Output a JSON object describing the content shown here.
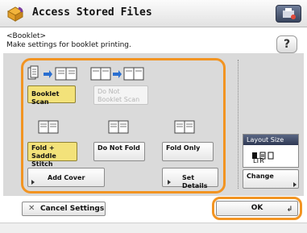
{
  "title": "Access Stored Files",
  "header": {
    "line1": "<Booklet>",
    "line2": "Make settings for booklet printing."
  },
  "help_label": "?",
  "options": {
    "booklet_scan": "Booklet Scan",
    "do_not_booklet_scan_1": "Do Not",
    "do_not_booklet_scan_2": "Booklet Scan",
    "fold_saddle_1": "Fold +",
    "fold_saddle_2": "Saddle Stitch",
    "do_not_fold": "Do Not Fold",
    "fold_only": "Fold Only",
    "add_cover": "Add Cover",
    "set_details": "Set Details"
  },
  "layout_size": {
    "header": "Layout Size",
    "size": "LTR",
    "change": "Change"
  },
  "footer": {
    "cancel": "Cancel Settings",
    "ok": "OK"
  },
  "colors": {
    "accent_orange": "#f29422",
    "selected_yellow": "#f3e27a"
  }
}
